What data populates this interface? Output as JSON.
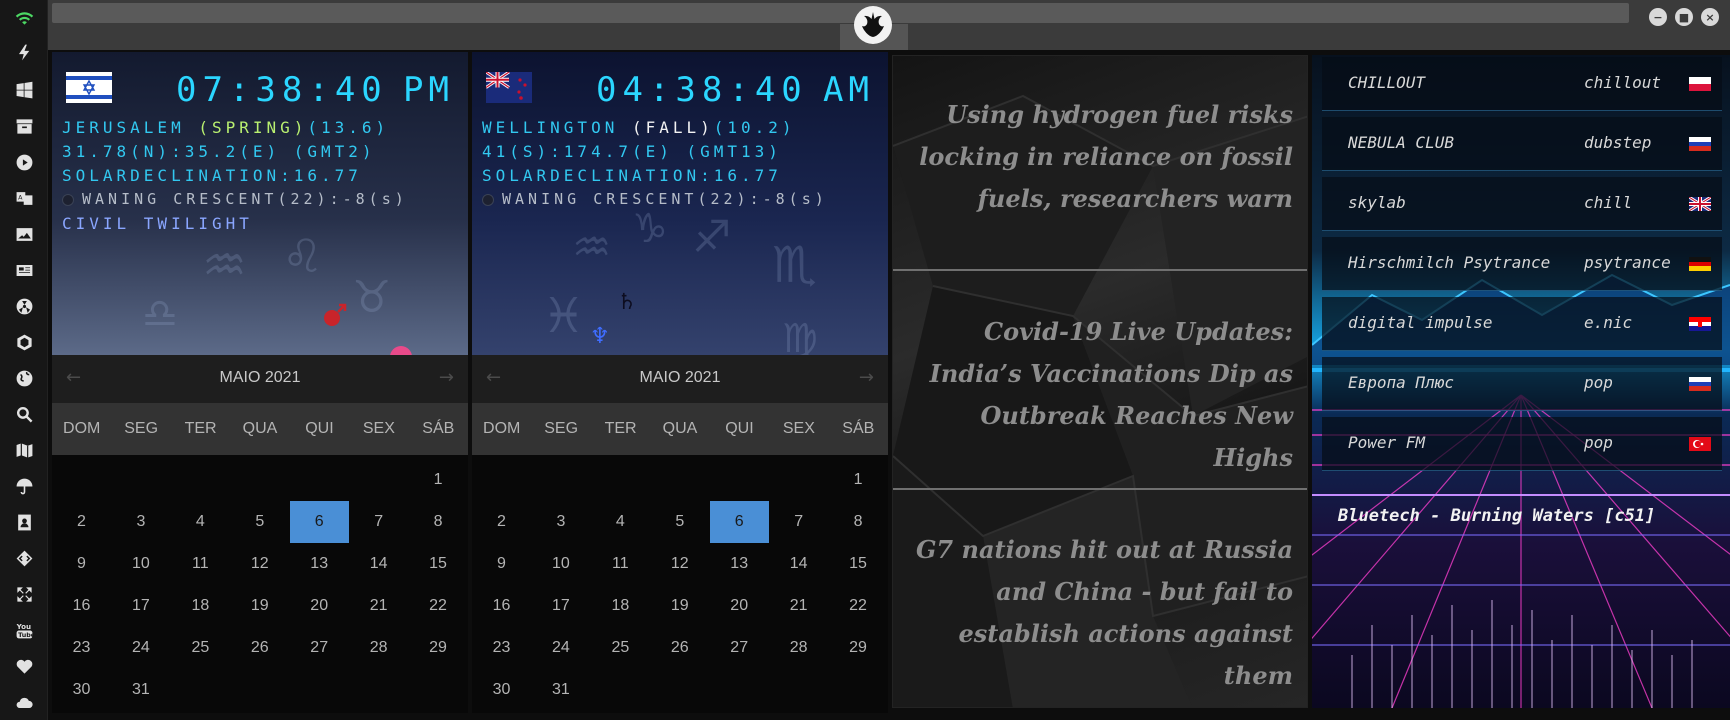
{
  "dock": {
    "icons": [
      "wifi-icon",
      "lightning-icon",
      "windows-icon",
      "archive-icon",
      "play-icon",
      "translate-icon",
      "image-icon",
      "news-icon",
      "radiation-icon",
      "hexagon-icon",
      "globe-icon",
      "search-icon",
      "map-icon",
      "umbrella-icon",
      "contact-icon",
      "code-icon",
      "fullscreen-icon",
      "youtube-icon",
      "heart-icon",
      "cloud-icon"
    ]
  },
  "titlebar": {
    "logo": "rebel-alliance-icon"
  },
  "clocks": [
    {
      "time": "07:38:40",
      "ampm": "PM",
      "city": "JERUSALEM ",
      "season": "(SPRING)",
      "temp": "(13.6)",
      "coords": "31.78(N):35.2(E) (GMT2)",
      "solar": "SOLARDECLINATION:16.77",
      "moon": "WANING CRESCENT(22):-8(s)",
      "twilight": "CIVIL TWILIGHT"
    },
    {
      "time": "04:38:40",
      "ampm": "AM",
      "city": "WELLINGTON ",
      "season": "(FALL)",
      "temp": "(10.2)",
      "coords": "41(S):174.7(E) (GMT13)",
      "solar": "SOLARDECLINATION:16.77",
      "moon": "WANING CRESCENT(22):-8(s)",
      "twilight": ""
    }
  ],
  "calendar": {
    "title": "MAIO 2021",
    "prev": "←",
    "next": "→",
    "weekdays": [
      "DOM",
      "SEG",
      "TER",
      "QUA",
      "QUI",
      "SEX",
      "SÁB"
    ],
    "first_weekday": 6,
    "days": 31,
    "today": 6
  },
  "news": [
    "Using hydrogen fuel risks locking in reliance on fossil fuels, researchers warn",
    "Covid-19 Live Updates: India’s Vaccinations Dip as Outbreak Reaches New Highs",
    "G7 nations hit out at Russia and China - but fail to establish actions against them"
  ],
  "radio": {
    "stations": [
      {
        "name": "CHILLOUT",
        "genre": "chillout",
        "flag": "poland-flag"
      },
      {
        "name": "NEBULA CLUB",
        "genre": "dubstep",
        "flag": "russia-flag"
      },
      {
        "name": "skylab",
        "genre": "chill",
        "flag": "uk-flag"
      },
      {
        "name": "Hirschmilch Psytrance",
        "genre": "psytrance",
        "flag": "germany-flag"
      },
      {
        "name": "digital impulse",
        "genre": "e.nic",
        "flag": "croatia-flag"
      },
      {
        "name": "Европа Плюс",
        "genre": "pop",
        "flag": "russia-flag"
      },
      {
        "name": "Power FM",
        "genre": "pop",
        "flag": "turkey-flag"
      }
    ],
    "now_playing": "Bluetech - Burning Waters [c51]"
  }
}
